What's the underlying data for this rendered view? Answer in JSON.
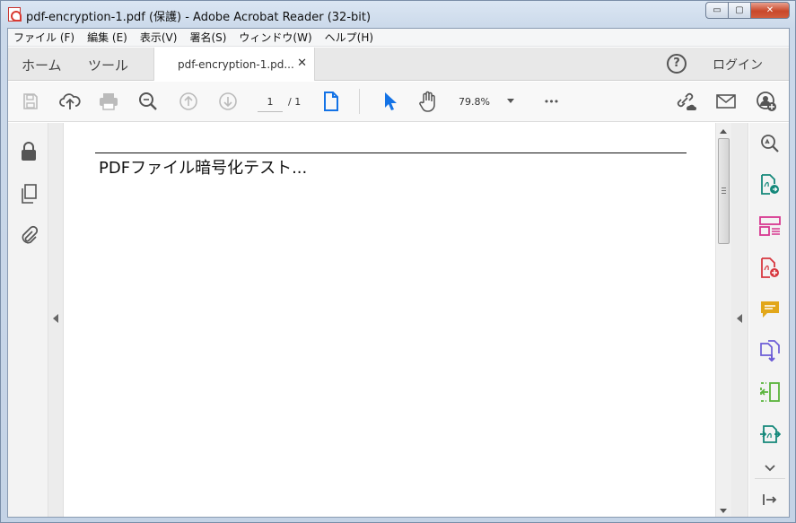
{
  "window": {
    "title": "pdf-encryption-1.pdf (保護) - Adobe Acrobat Reader (32-bit)",
    "minimize_glyph": "▭",
    "maximize_glyph": "▢",
    "close_glyph": "✕"
  },
  "menu": {
    "items": [
      "ファイル (F)",
      "編集 (E)",
      "表示(V)",
      "署名(S)",
      "ウィンドウ(W)",
      "ヘルプ(H)"
    ]
  },
  "tabs": {
    "home": "ホーム",
    "tools": "ツール",
    "document": "pdf-encryption-1.pd...",
    "close_glyph": "✕",
    "help_glyph": "?",
    "login": "ログイン"
  },
  "toolbar": {
    "page_current": "1",
    "page_total": "/ 1",
    "zoom": "79.8%",
    "more_glyph": "•••"
  },
  "document": {
    "text": "PDFファイル暗号化テスト..."
  },
  "colors": {
    "accent_blue": "#1473e6",
    "adobe_red": "#d7373f",
    "title_bar": "#cbd9ea"
  },
  "icons": {
    "toolbar": [
      "save-icon",
      "upload-cloud-icon",
      "print-icon",
      "zoom-search-icon",
      "previous-page-icon",
      "next-page-icon",
      "page-view-icon",
      "select-cursor-icon",
      "hand-tool-icon",
      "more-options-icon",
      "share-link-icon",
      "email-icon",
      "add-user-icon"
    ],
    "left": [
      "lock-icon",
      "pages-icon",
      "attachment-icon"
    ],
    "right": [
      "enhance-scan-icon",
      "export-pdf-icon",
      "organize-pages-icon",
      "create-pdf-icon",
      "comment-icon",
      "combine-files-icon",
      "compress-icon",
      "sign-icon",
      "expand-more-icon",
      "collapse-pane-icon"
    ]
  }
}
